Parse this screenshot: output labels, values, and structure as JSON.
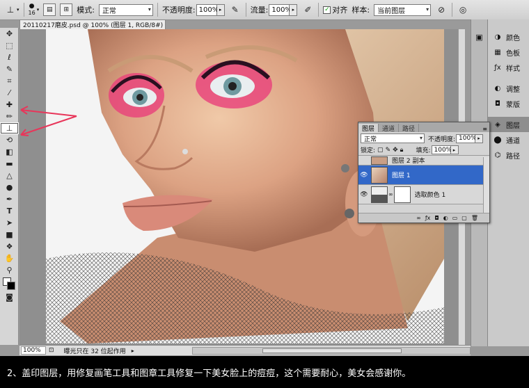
{
  "options_bar": {
    "brush_size": "16",
    "mode_label": "模式:",
    "mode_value": "正常",
    "opacity_label": "不透明度:",
    "opacity_value": "100%",
    "flow_label": "流量:",
    "flow_value": "100%",
    "aligned_label": "对齐",
    "sample_label": "样本:",
    "sample_value": "当前图层"
  },
  "document": {
    "tab_title": "20110217磨皮.psd @ 100% (图层 1, RGB/8#) *",
    "tab_close": "×",
    "zoom": "100%",
    "status_info": "曝光只在 32 位起作用"
  },
  "dock": {
    "items": [
      "颜色",
      "色板",
      "样式",
      "调整",
      "蒙版",
      "图层",
      "通道",
      "路径"
    ]
  },
  "layers_panel": {
    "tabs": [
      "图层",
      "通道",
      "路径"
    ],
    "blend_mode": "正常",
    "opacity_label": "不透明度:",
    "opacity_value": "100%",
    "lock_label": "锁定:",
    "fill_label": "填充:",
    "fill_value": "100%",
    "layers": [
      "图层 2 副本",
      "图层 1",
      "选取颜色 1"
    ]
  },
  "caption": "2、盖印图层，用修复画笔工具和图章工具修复一下美女脸上的痘痘，这个需要耐心，美女会感谢你。",
  "colors": {
    "selection": "#3268c8",
    "annotation_arrow": "#e8365a"
  }
}
